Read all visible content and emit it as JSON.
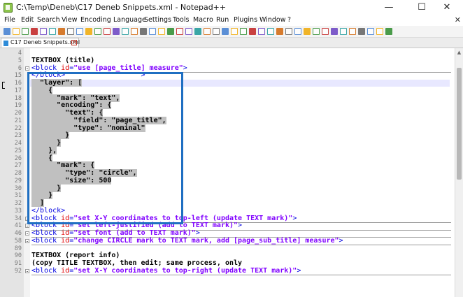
{
  "window": {
    "title": "C:\\Temp\\Deneb\\C17 Deneb Snippets.xml - Notepad++",
    "minimize": "—",
    "maximize": "☐",
    "close": "✕"
  },
  "menu": {
    "items": [
      "File",
      "Edit",
      "Search",
      "View",
      "Encoding",
      "Language",
      "Settings",
      "Tools",
      "Macro",
      "Run",
      "Plugins",
      "Window",
      "?"
    ],
    "close_doc": "✕"
  },
  "toolbar": {
    "icons": [
      "new-file-icon",
      "open-file-icon",
      "save-icon",
      "save-all-icon",
      "close-icon",
      "close-all-icon",
      "print-icon",
      "cut-icon",
      "copy-icon",
      "paste-icon",
      "undo-icon",
      "redo-icon",
      "find-icon",
      "replace-icon",
      "zoom-in-icon",
      "zoom-out-icon",
      "sync-v-icon",
      "sync-h-icon",
      "word-wrap-icon",
      "all-chars-icon",
      "indent-guide-icon",
      "udl-icon",
      "doc-map-icon",
      "function-list-icon",
      "folder-workspace-icon",
      "monitor-icon",
      "record-macro-icon",
      "stop-macro-icon",
      "play-macro-icon",
      "run-macro-multi-icon",
      "save-macro-icon",
      "plugin-1-icon",
      "plugin-2-icon",
      "plugin-3-icon",
      "plugin-4-icon",
      "plugin-5-icon",
      "plugin-6-icon",
      "plugin-7-icon",
      "plugin-8-icon",
      "plugin-9-icon",
      "plugin-10-icon",
      "plugin-11-icon",
      "plugin-12-icon"
    ]
  },
  "tab": {
    "label": "C17 Deneb Snippets.xml",
    "close": "✕"
  },
  "editor": {
    "lines": [
      {
        "num": "4",
        "tokens": []
      },
      {
        "num": "5",
        "tokens": [
          {
            "t": "TEXTBOX (title)",
            "c": "bold"
          }
        ]
      },
      {
        "num": "6",
        "fold": true,
        "tokens": [
          {
            "t": "<block ",
            "c": "tag"
          },
          {
            "t": "id",
            "c": "attr"
          },
          {
            "t": "=",
            "c": "eq"
          },
          {
            "t": "\"use [page_title] measure\"",
            "c": "val"
          },
          {
            "t": ">",
            "c": "tag"
          }
        ]
      },
      {
        "num": "15",
        "tokens": [
          {
            "t": "</block>",
            "c": "tag"
          },
          {
            "t": "                  ",
            "c": "plain"
          },
          {
            "t": ">",
            "c": "tag"
          }
        ]
      },
      {
        "num": "16",
        "current": true,
        "tokens": [
          {
            "t": "  \"layer\": [",
            "c": "json",
            "sel": true
          }
        ]
      },
      {
        "num": "17",
        "tokens": [
          {
            "t": "    {",
            "c": "json",
            "sel": true
          }
        ]
      },
      {
        "num": "18",
        "tokens": [
          {
            "t": "      \"mark\": \"text\",",
            "c": "json",
            "sel": true
          }
        ]
      },
      {
        "num": "19",
        "tokens": [
          {
            "t": "      \"encoding\": {",
            "c": "json",
            "sel": true
          }
        ]
      },
      {
        "num": "20",
        "tokens": [
          {
            "t": "        \"text\": {",
            "c": "json",
            "sel": true
          }
        ]
      },
      {
        "num": "21",
        "tokens": [
          {
            "t": "          \"field\": \"page_title\",",
            "c": "json",
            "sel": true
          }
        ]
      },
      {
        "num": "22",
        "tokens": [
          {
            "t": "          \"type\": \"nominal\"",
            "c": "json",
            "sel": true
          }
        ]
      },
      {
        "num": "23",
        "tokens": [
          {
            "t": "        }",
            "c": "json",
            "sel": true
          }
        ]
      },
      {
        "num": "24",
        "tokens": [
          {
            "t": "      }",
            "c": "json",
            "sel": true
          }
        ]
      },
      {
        "num": "25",
        "tokens": [
          {
            "t": "    },",
            "c": "json",
            "sel": true
          }
        ]
      },
      {
        "num": "26",
        "tokens": [
          {
            "t": "    {",
            "c": "json",
            "sel": true
          }
        ]
      },
      {
        "num": "27",
        "tokens": [
          {
            "t": "      \"mark\": {",
            "c": "json",
            "sel": true
          }
        ]
      },
      {
        "num": "28",
        "tokens": [
          {
            "t": "        \"type\": \"circle\",",
            "c": "json",
            "sel": true
          }
        ]
      },
      {
        "num": "29",
        "tokens": [
          {
            "t": "        \"size\": 500",
            "c": "json",
            "sel": true
          }
        ]
      },
      {
        "num": "30",
        "tokens": [
          {
            "t": "      }",
            "c": "json",
            "sel": true
          }
        ]
      },
      {
        "num": "31",
        "tokens": [
          {
            "t": "    }",
            "c": "json",
            "sel": true
          }
        ]
      },
      {
        "num": "32",
        "tokens": [
          {
            "t": "  ]",
            "c": "json",
            "sel": true
          }
        ]
      },
      {
        "num": "33",
        "tokens": [
          {
            "t": "</block>",
            "c": "tag"
          }
        ]
      },
      {
        "num": "34",
        "fold": true,
        "tokens": [
          {
            "t": "<block ",
            "c": "tag"
          },
          {
            "t": "id",
            "c": "attr"
          },
          {
            "t": "=",
            "c": "eq"
          },
          {
            "t": "\"set X-Y coordinates to top-left (update TEXT mark)\"",
            "c": "val"
          },
          {
            "t": ">",
            "c": "tag"
          }
        ]
      },
      {
        "num": "41",
        "fold": true,
        "tokens": [
          {
            "t": "<block ",
            "c": "tag"
          },
          {
            "t": "id",
            "c": "attr"
          },
          {
            "t": "=",
            "c": "eq"
          },
          {
            "t": "\"set left-justified (add to TEXT mark)\"",
            "c": "val"
          },
          {
            "t": ">",
            "c": "tag"
          }
        ]
      },
      {
        "num": "46",
        "fold": true,
        "tokens": [
          {
            "t": "<block ",
            "c": "tag"
          },
          {
            "t": "id",
            "c": "attr"
          },
          {
            "t": "=",
            "c": "eq"
          },
          {
            "t": "\"set font (add to TEXT mark)\"",
            "c": "val"
          },
          {
            "t": ">",
            "c": "tag"
          }
        ]
      },
      {
        "num": "58",
        "fold": true,
        "tokens": [
          {
            "t": "<block ",
            "c": "tag"
          },
          {
            "t": "id",
            "c": "attr"
          },
          {
            "t": "=",
            "c": "eq"
          },
          {
            "t": "\"change CIRCLE mark to TEXT mark, add [page_sub_title] measure\"",
            "c": "val"
          },
          {
            "t": ">",
            "c": "tag"
          }
        ]
      },
      {
        "num": "89",
        "tokens": []
      },
      {
        "num": "90",
        "tokens": [
          {
            "t": "TEXTBOX (report info)",
            "c": "bold"
          }
        ]
      },
      {
        "num": "91",
        "tokens": [
          {
            "t": "(copy TITLE TEXTBOX, then edit; same process, only",
            "c": "bold"
          }
        ]
      },
      {
        "num": "92",
        "fold": true,
        "tokens": [
          {
            "t": "<block ",
            "c": "tag"
          },
          {
            "t": "id",
            "c": "attr"
          },
          {
            "t": "=",
            "c": "eq"
          },
          {
            "t": "\"set X-Y coordinates to top-right (update TEXT mark)\"",
            "c": "val"
          },
          {
            "t": ">",
            "c": "tag"
          }
        ]
      }
    ]
  },
  "colors": {
    "highlight_frame": "#1f6fc2",
    "selection": "#c0c0c0",
    "tag": "#0000e0",
    "attr": "#e00000",
    "value": "#8000ff"
  }
}
